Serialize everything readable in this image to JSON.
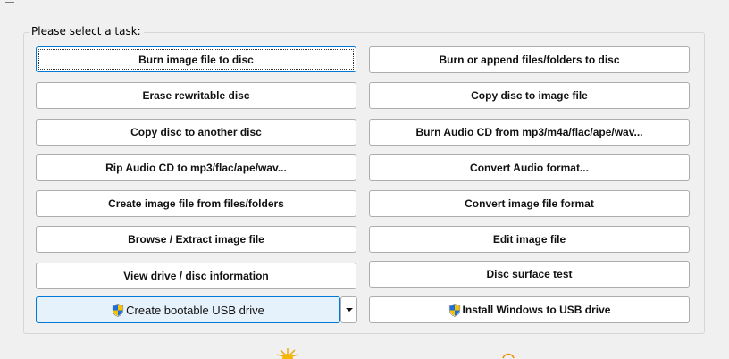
{
  "window": {
    "group_label": "Please select a task:"
  },
  "tasks": {
    "left": [
      {
        "id": "burn-image",
        "label": "Burn image file to disc"
      },
      {
        "id": "erase",
        "label": "Erase rewritable disc"
      },
      {
        "id": "copy-disc",
        "label": "Copy disc to another disc"
      },
      {
        "id": "rip-audio",
        "label": "Rip Audio CD to mp3/flac/ape/wav..."
      },
      {
        "id": "create-image",
        "label": "Create image file from files/folders"
      },
      {
        "id": "browse-image",
        "label": "Browse / Extract image file"
      },
      {
        "id": "drive-info",
        "label": "View drive / disc information"
      },
      {
        "id": "bootable-usb",
        "label": "Create bootable USB drive"
      }
    ],
    "right": [
      {
        "id": "burn-files",
        "label": "Burn or append files/folders to disc"
      },
      {
        "id": "copy-to-image",
        "label": "Copy disc to image file"
      },
      {
        "id": "burn-audio",
        "label": "Burn Audio CD from mp3/m4a/flac/ape/wav..."
      },
      {
        "id": "convert-audio",
        "label": "Convert Audio format..."
      },
      {
        "id": "convert-image",
        "label": "Convert image file format"
      },
      {
        "id": "edit-image",
        "label": "Edit image file"
      },
      {
        "id": "surface-test",
        "label": "Disc surface test"
      },
      {
        "id": "install-windows",
        "label": "Install Windows to USB drive"
      }
    ]
  },
  "icons": {
    "shield": "uac-shield-icon",
    "dropdown": "chevron-down-icon"
  },
  "colors": {
    "accent": "#0078d7",
    "selected_bg": "#e5f1fb",
    "button_border": "#adadad",
    "window_bg": "#f0f0f0"
  }
}
